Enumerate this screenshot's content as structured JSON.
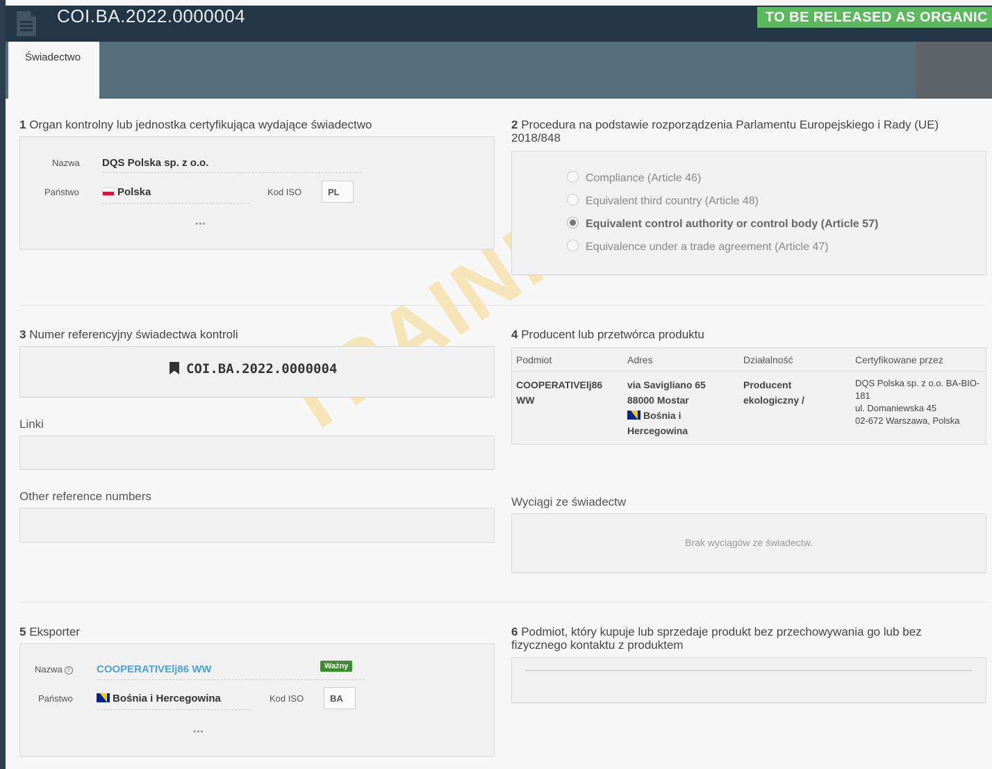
{
  "header": {
    "title": "COI.BA.2022.0000004",
    "status_badge": "TO BE RELEASED AS ORGANIC",
    "badge_color": "#5cb85c"
  },
  "tabs": [
    {
      "label": "Świadectwo"
    }
  ],
  "watermark": "TRAINING",
  "section1": {
    "num": "1",
    "title": "Organ kontrolny lub jednostka certyfikująca wydające świadectwo",
    "name_label": "Nazwa",
    "name_value": "DQS Polska sp. z o.o.",
    "country_label": "Państwo",
    "country_value": "Polska",
    "country_flag": "flag-pl-icon",
    "iso_label": "Kod ISO",
    "iso_value": "PL",
    "more": "•••"
  },
  "section2": {
    "num": "2",
    "title": "Procedura na podstawie rozporządzenia Parlamentu Europejskiego i Rady (UE) 2018/848",
    "options": [
      {
        "label": "Compliance (Article 46)",
        "selected": false
      },
      {
        "label": "Equivalent third country (Article 48)",
        "selected": false
      },
      {
        "label": "Equivalent control authority or control body (Article 57)",
        "selected": true
      },
      {
        "label": "Equivalence under a trade agreement (Article 47)",
        "selected": false
      }
    ]
  },
  "section3": {
    "num": "3",
    "title": "Numer referencyjny świadectwa kontroli",
    "ref_value": "COI.BA.2022.0000004",
    "links_label": "Linki",
    "links_value": "",
    "other_label": "Other reference numbers",
    "other_value": ""
  },
  "section4": {
    "num": "4",
    "title": "Producent lub przetwórca produktu",
    "columns": [
      "Podmiot",
      "Adres",
      "Działalność",
      "Certyfikowane przez"
    ],
    "row": {
      "entity": "COOPERATIVElj86 WW",
      "address_line1": "via Savigliano 65",
      "address_line2": "88000 Mostar",
      "address_country": "Bośnia i Hercegowina",
      "activity": "Producent ekologiczny /",
      "cert_line1": "DQS Polska sp. z o.o. BA-BIO-181",
      "cert_line2": "ul. Domaniewska 45",
      "cert_line3": "02-672 Warszawa, Polska"
    }
  },
  "extracts": {
    "title": "Wyciągi ze świadectw",
    "empty_text": "Brak wyciągów ze świadectw."
  },
  "section5": {
    "num": "5",
    "title": "Eksporter",
    "name_label": "Nazwa",
    "name_value": "COOPERATIVElj86 WW",
    "status": "Ważny",
    "status_color": "#3c8d2f",
    "country_label": "Państwo",
    "country_value": "Bośnia i Hercegowina",
    "country_flag": "flag-ba-icon",
    "iso_label": "Kod ISO",
    "iso_value": "BA",
    "more": "•••"
  },
  "section6": {
    "num": "6",
    "title": "Podmiot, który kupuje lub sprzedaje produkt bez przechowywania go lub bez fizycznego kontaktu z produktem"
  }
}
